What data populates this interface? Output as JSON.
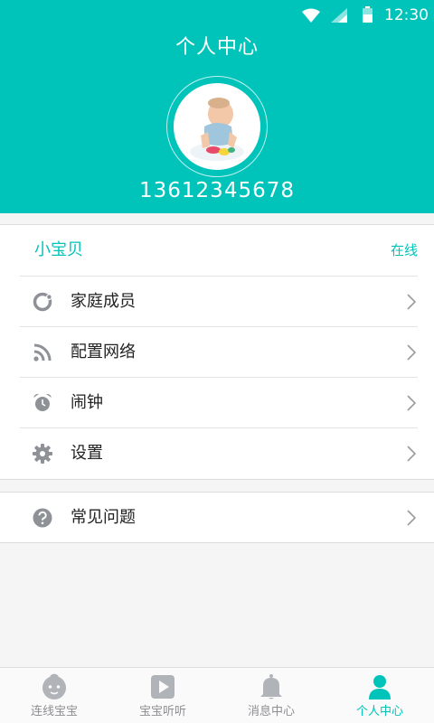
{
  "status_bar": {
    "time": "12:30"
  },
  "header": {
    "title": "个人中心",
    "phone": "13612345678"
  },
  "device": {
    "name": "小宝贝",
    "status": "在线"
  },
  "menu": [
    {
      "label": "家庭成员",
      "icon": "family-icon"
    },
    {
      "label": "配置网络",
      "icon": "network-icon"
    },
    {
      "label": "闹钟",
      "icon": "alarm-clock-icon"
    },
    {
      "label": "设置",
      "icon": "gear-icon"
    }
  ],
  "faq": {
    "label": "常见问题",
    "icon": "question-icon"
  },
  "tabs": [
    {
      "label": "连线宝宝",
      "icon": "baby-face-icon",
      "active": false
    },
    {
      "label": "宝宝听听",
      "icon": "play-icon",
      "active": false
    },
    {
      "label": "消息中心",
      "icon": "bell-icon",
      "active": false
    },
    {
      "label": "个人中心",
      "icon": "person-icon",
      "active": true
    }
  ],
  "colors": {
    "accent": "#00c4ba",
    "icon_gray": "#8e9196",
    "tab_inactive": "#b0b3b8",
    "background": "#f5f5f5"
  }
}
